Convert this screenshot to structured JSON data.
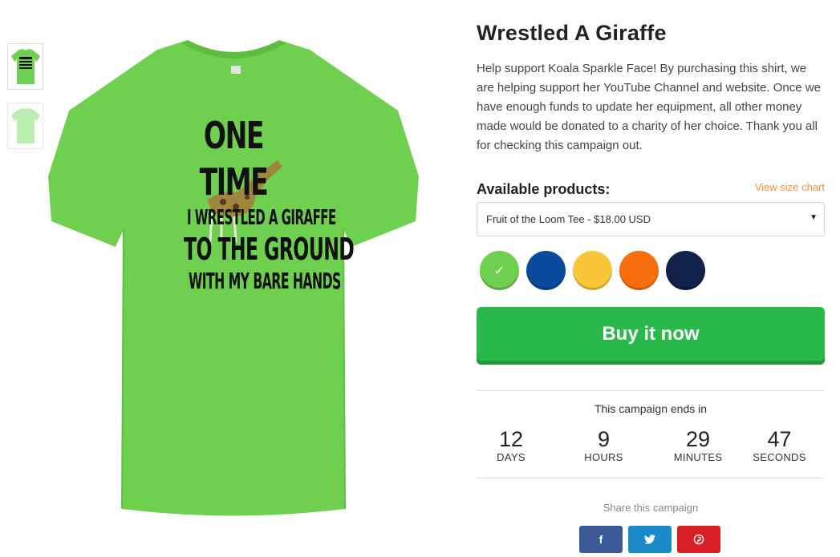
{
  "product": {
    "title": "Wrestled A Giraffe",
    "description": "Help support Koala Sparkle Face! By purchasing this shirt, we are helping support her YouTube Channel and website. Once we have enough funds to update her equipment, all other money made would be donated to a charity of her choice. Thank you all for checking this campaign out.",
    "design_lines": [
      "ONE TIME",
      "I WRESTLED A GIRAFFE",
      "TO THE GROUND",
      "WITH MY BARE HANDS"
    ]
  },
  "products": {
    "label": "Available products:",
    "size_chart_link": "View size chart",
    "selected": "Fruit of the Loom Tee - $18.00 USD"
  },
  "colors": [
    {
      "name": "lime",
      "hex": "#6fd04f",
      "selected": true
    },
    {
      "name": "royal-blue",
      "hex": "#0a4a9e",
      "selected": false
    },
    {
      "name": "gold",
      "hex": "#f8c63a",
      "selected": false
    },
    {
      "name": "orange",
      "hex": "#f86d0c",
      "selected": false
    },
    {
      "name": "navy",
      "hex": "#10214a",
      "selected": false
    }
  ],
  "buy_button": "Buy it now",
  "campaign": {
    "ends_label": "This campaign ends in",
    "countdown": [
      {
        "value": "12",
        "unit": "DAYS"
      },
      {
        "value": "9",
        "unit": "HOURS"
      },
      {
        "value": "29",
        "unit": "MINUTES"
      },
      {
        "value": "47",
        "unit": "SECONDS"
      }
    ]
  },
  "share": {
    "label": "Share this campaign",
    "buttons": [
      {
        "icon": "facebook-icon",
        "glyph": "f",
        "color": "#3b5998"
      },
      {
        "icon": "twitter-icon",
        "glyph": "t",
        "color": "#1a8bc7"
      },
      {
        "icon": "pinterest-icon",
        "glyph": "p",
        "color": "#d81f26"
      }
    ]
  },
  "theme": {
    "accent_green": "#28b94a",
    "accent_orange": "#f0913e",
    "shirt_color": "#6fd04f"
  }
}
